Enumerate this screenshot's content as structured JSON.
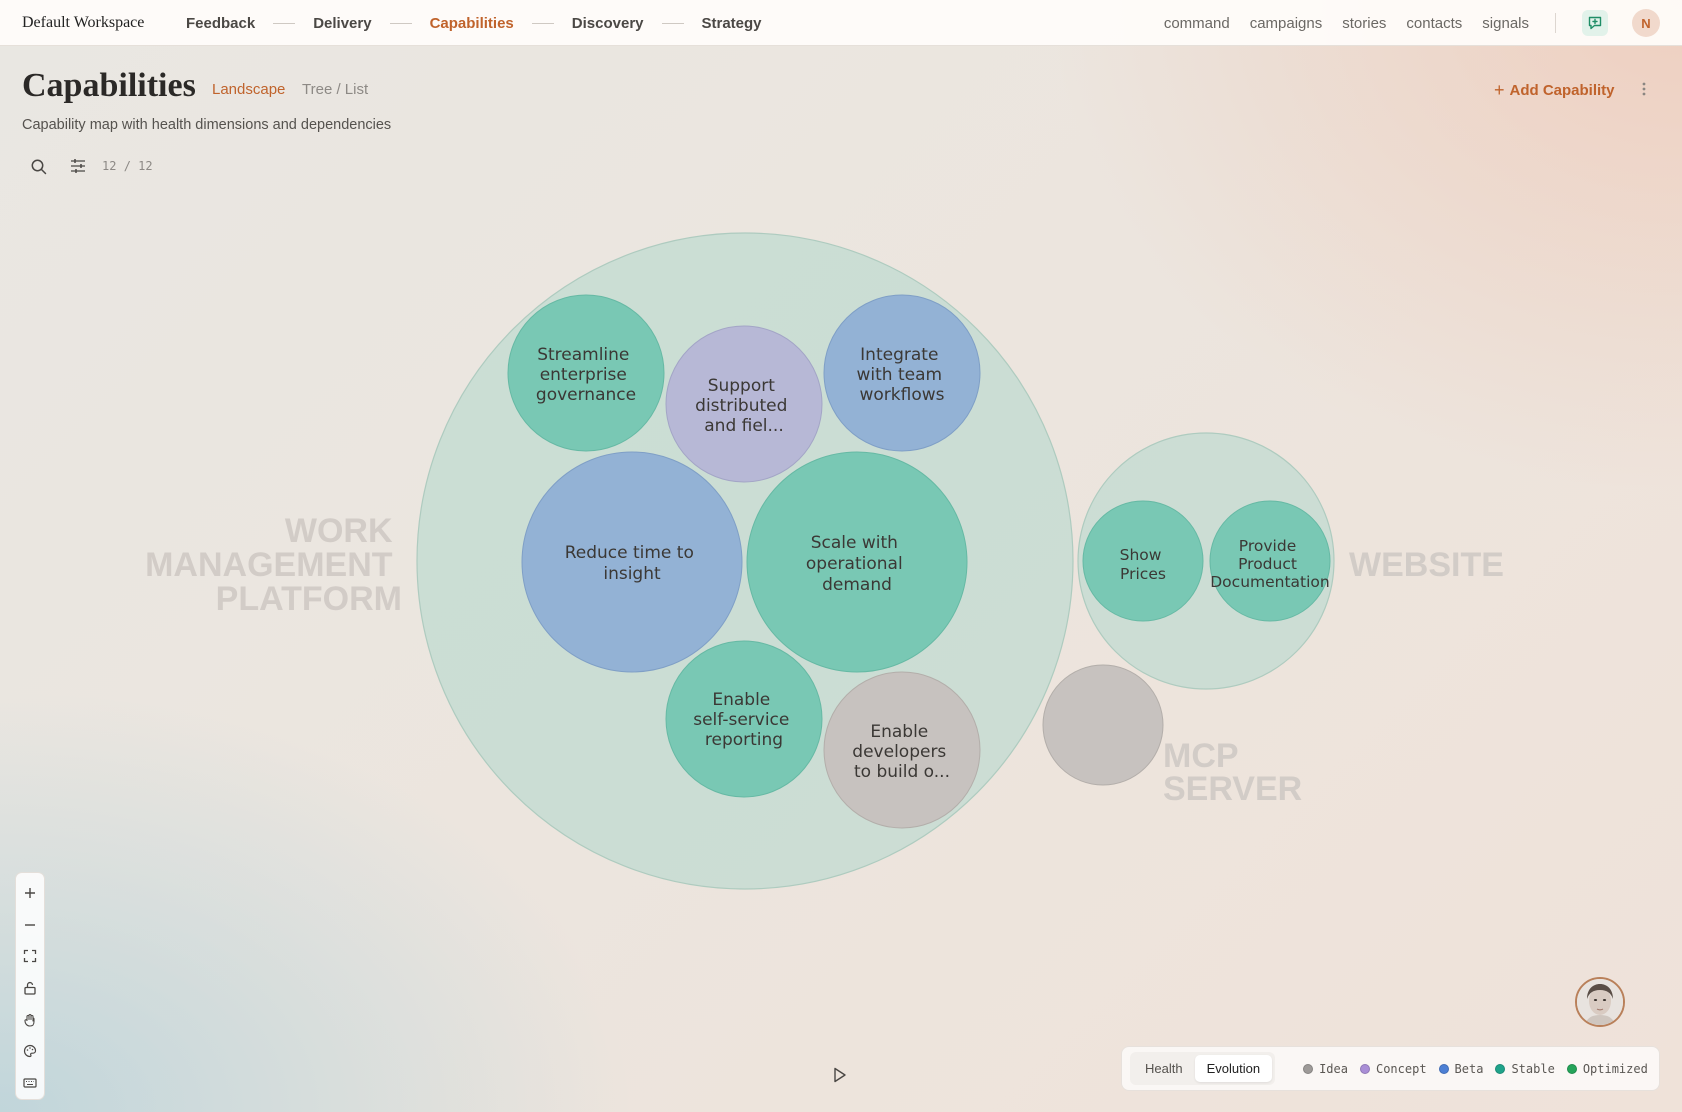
{
  "workspace": "Default Workspace",
  "nav": {
    "items": [
      {
        "label": "Feedback"
      },
      {
        "label": "Delivery"
      },
      {
        "label": "Capabilities",
        "active": true
      },
      {
        "label": "Discovery"
      },
      {
        "label": "Strategy"
      }
    ],
    "utilities": [
      "command",
      "campaigns",
      "stories",
      "contacts",
      "signals"
    ],
    "user_initial": "N",
    "accent_color": "#c0632c"
  },
  "page": {
    "title": "Capabilities",
    "views": [
      "Landscape",
      "Tree / List"
    ],
    "active_view": "Landscape",
    "subtitle": "Capability map with health dimensions and dependencies",
    "add_button": "Add Capability",
    "count_shown": "12",
    "count_sep": "/",
    "count_total": "12"
  },
  "map": {
    "clusters": [
      {
        "name_lines": [
          "WORK",
          "MANAGEMENT",
          "PLATFORM"
        ],
        "capabilities": [
          {
            "lines": [
              "Streamline",
              "enterprise",
              "governance"
            ],
            "stage": "Stable"
          },
          {
            "lines": [
              "Support",
              "distributed",
              "and fiel..."
            ],
            "stage": "Concept"
          },
          {
            "lines": [
              "Integrate",
              "with team",
              "workflows"
            ],
            "stage": "Beta"
          },
          {
            "lines": [
              "Reduce time to",
              "insight"
            ],
            "stage": "Beta"
          },
          {
            "lines": [
              "Scale with",
              "operational",
              "demand"
            ],
            "stage": "Stable"
          },
          {
            "lines": [
              "Enable",
              "self-service",
              "reporting"
            ],
            "stage": "Stable"
          },
          {
            "lines": [
              "Enable",
              "developers",
              "to build o..."
            ],
            "stage": "Idea"
          }
        ]
      },
      {
        "name_lines": [
          "WEBSITE"
        ],
        "capabilities": [
          {
            "lines": [
              "Show",
              "Prices"
            ],
            "stage": "Stable"
          },
          {
            "lines": [
              "Provide",
              "Product",
              "Documentation"
            ],
            "stage": "Stable"
          }
        ]
      },
      {
        "name_lines": [
          "MCP",
          "SERVER"
        ],
        "capabilities": [
          {
            "lines": [],
            "stage": "Idea"
          }
        ]
      }
    ]
  },
  "legend": {
    "modes": [
      "Health",
      "Evolution"
    ],
    "active_mode": "Evolution",
    "stages": [
      {
        "label": "Idea",
        "color": "#9d9a98"
      },
      {
        "label": "Concept",
        "color": "#a98ed6"
      },
      {
        "label": "Beta",
        "color": "#4c7fd4"
      },
      {
        "label": "Stable",
        "color": "#1fa38a"
      },
      {
        "label": "Optimized",
        "color": "#25a45a"
      }
    ]
  },
  "bubble_colors": {
    "Idea": "#c7c2bf",
    "Concept": "#b7b8d6",
    "Beta": "#93b2d5",
    "Stable": "#79c8b4",
    "cluster_fill": "#c6dcd2"
  }
}
